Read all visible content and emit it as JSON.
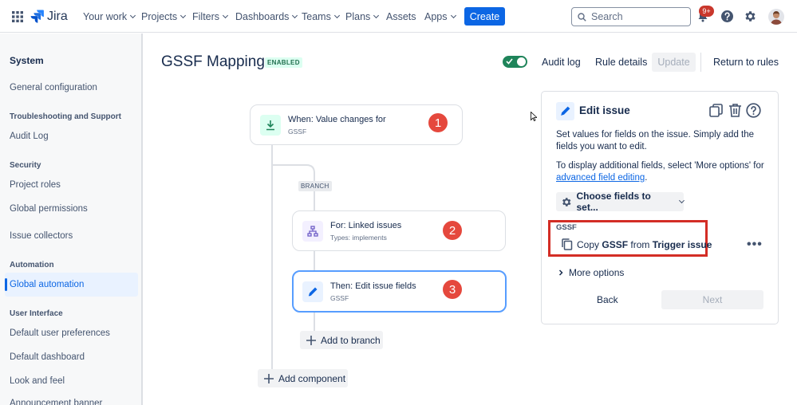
{
  "topnav": {
    "logo_text": "Jira",
    "items": [
      "Your work",
      "Projects",
      "Filters",
      "Dashboards",
      "Teams",
      "Plans",
      "Assets",
      "Apps"
    ],
    "create_label": "Create",
    "search_placeholder": "Search",
    "notifications_badge": "9+"
  },
  "sidebar": {
    "title": "System",
    "general": "General configuration",
    "troubleshooting_heading": "Troubleshooting and Support",
    "audit_log": "Audit Log",
    "security_heading": "Security",
    "project_roles": "Project roles",
    "global_permissions": "Global permissions",
    "issue_collectors": "Issue collectors",
    "automation_heading": "Automation",
    "global_automation": "Global automation",
    "ui_heading": "User Interface",
    "default_user_prefs": "Default user preferences",
    "default_dashboard": "Default dashboard",
    "look_and_feel": "Look and feel",
    "announcement_banner": "Announcement banner"
  },
  "header": {
    "title": "GSSF Mapping",
    "status": "ENABLED",
    "audit_log": "Audit log",
    "rule_details": "Rule details",
    "update": "Update",
    "return_to_rules": "Return to rules"
  },
  "flow": {
    "trigger": {
      "title": "When: Value changes for",
      "subtitle": "GSSF",
      "number": "1"
    },
    "branch_label": "BRANCH",
    "branch_card": {
      "title": "For: Linked issues",
      "subtitle": "Types: implements",
      "number": "2"
    },
    "action_card": {
      "title": "Then: Edit issue fields",
      "subtitle": "GSSF",
      "number": "3"
    },
    "add_to_branch": "Add to branch",
    "add_component": "Add component"
  },
  "panel": {
    "title": "Edit issue",
    "desc_line1": "Set values for fields on the issue. Simply add the",
    "desc_line2": "fields you want to edit.",
    "display_line1": "To display additional fields, select 'More options' for",
    "advanced_link": "advanced field editing",
    "period": ".",
    "choose_fields": "Choose fields to set...",
    "field_label": "GSSF",
    "copy_prefix": "Copy",
    "copy_field": "GSSF",
    "copy_from": "from",
    "copy_source": "Trigger issue",
    "more_options": "More options",
    "back": "Back",
    "next": "Next"
  },
  "colors": {
    "primary": "#0c66e4",
    "badge_red": "#c9372c",
    "toggle_green": "#1f845a",
    "step_number_red": "#e5483d",
    "highlight_box": "#d32d25"
  }
}
